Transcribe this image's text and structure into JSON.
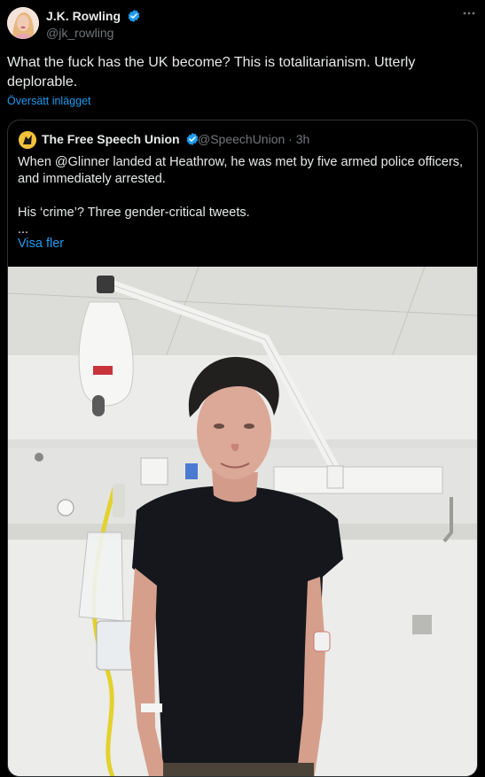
{
  "author": {
    "name": "J.K. Rowling",
    "handle": "@jk_rowling",
    "verified": true
  },
  "tweet": {
    "text": "What the fuck has the UK become? This is totalitarianism. Utterly deplorable.",
    "translate_label": "Översätt inlägget",
    "more_icon": "more-horizontal-icon"
  },
  "quoted": {
    "name": "The Free Speech Union",
    "handle": "@SpeechUnion",
    "separator": "·",
    "time": "3h",
    "verified": true,
    "line1": "When @Glinner landed at Heathrow, he was met by five armed police officers, and immediately arrested.",
    "line2": "His ‘crime’? Three gender-critical tweets.",
    "line3": "...",
    "show_more": "Visa fler"
  },
  "colors": {
    "background": "#000000",
    "text": "#e7e9ea",
    "muted": "#71767b",
    "link": "#1d9bf0",
    "border": "#2f3336",
    "verified": "#1d9bf0"
  }
}
